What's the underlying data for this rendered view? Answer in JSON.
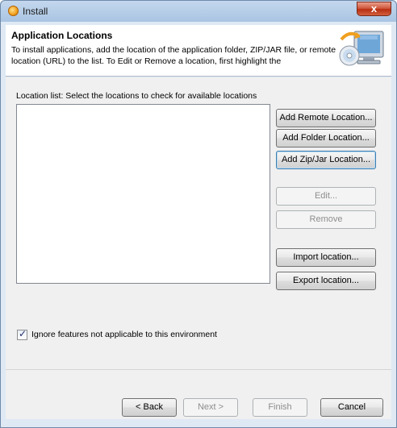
{
  "window": {
    "title": "Install",
    "close_glyph": "x"
  },
  "header": {
    "title": "Application Locations",
    "description": "To install applications, add the location of the application folder, ZIP/JAR file, or remote location (URL) to the list. To Edit or Remove a location, first highlight the",
    "graphic": "computer-cd-icon"
  },
  "locations": {
    "label": "Location list: Select the locations to check for available locations",
    "items": []
  },
  "buttons": {
    "add_remote": "Add Remote Location...",
    "add_folder": "Add Folder Location...",
    "add_zip": "Add Zip/Jar Location...",
    "edit": "Edit...",
    "remove": "Remove",
    "import": "Import location...",
    "export": "Export location..."
  },
  "option": {
    "label": "Ignore features not applicable to this environment",
    "checked": true
  },
  "footer": {
    "back": "< Back",
    "next": "Next >",
    "finish": "Finish",
    "cancel": "Cancel"
  },
  "colors": {
    "accent": "#3c7fb1",
    "close_button": "#c8452a",
    "frame": "#a9c4e2"
  }
}
